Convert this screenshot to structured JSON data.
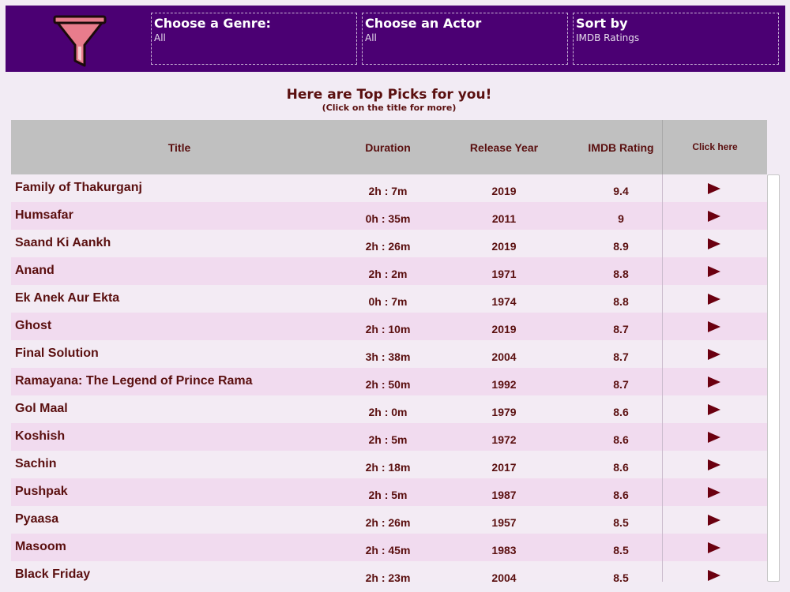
{
  "filters": {
    "genre": {
      "label": "Choose a Genre:",
      "value": "All"
    },
    "actor": {
      "label": "Choose an Actor",
      "value": "All"
    },
    "sort": {
      "label": "Sort by",
      "value": "IMDB Ratings"
    }
  },
  "heading": {
    "title": "Here are Top Picks for you!",
    "subtitle": "(Click on the title for more)"
  },
  "table": {
    "headers": {
      "title": "Title",
      "duration": "Duration",
      "year": "Release Year",
      "rating": "IMDB Rating",
      "click": "Click here"
    },
    "rows": [
      {
        "title": "Family of Thakurganj",
        "duration": "2h : 7m",
        "year": "2019",
        "rating": "9.4"
      },
      {
        "title": "Humsafar",
        "duration": "0h : 35m",
        "year": "2011",
        "rating": "9"
      },
      {
        "title": "Saand Ki Aankh",
        "duration": "2h : 26m",
        "year": "2019",
        "rating": "8.9"
      },
      {
        "title": "Anand",
        "duration": "2h : 2m",
        "year": "1971",
        "rating": "8.8"
      },
      {
        "title": "Ek Anek Aur Ekta",
        "duration": "0h : 7m",
        "year": "1974",
        "rating": "8.8"
      },
      {
        "title": "Ghost",
        "duration": "2h : 10m",
        "year": "2019",
        "rating": "8.7"
      },
      {
        "title": "Final Solution",
        "duration": "3h : 38m",
        "year": "2004",
        "rating": "8.7"
      },
      {
        "title": "Ramayana: The Legend of Prince Rama",
        "duration": "2h : 50m",
        "year": "1992",
        "rating": "8.7"
      },
      {
        "title": "Gol Maal",
        "duration": "2h : 0m",
        "year": "1979",
        "rating": "8.6"
      },
      {
        "title": "Koshish",
        "duration": "2h : 5m",
        "year": "1972",
        "rating": "8.6"
      },
      {
        "title": "Sachin",
        "duration": "2h : 18m",
        "year": "2017",
        "rating": "8.6"
      },
      {
        "title": "Pushpak",
        "duration": "2h : 5m",
        "year": "1987",
        "rating": "8.6"
      },
      {
        "title": "Pyaasa",
        "duration": "2h : 26m",
        "year": "1957",
        "rating": "8.5"
      },
      {
        "title": "Masoom",
        "duration": "2h : 45m",
        "year": "1983",
        "rating": "8.5"
      },
      {
        "title": "Black Friday",
        "duration": "2h : 23m",
        "year": "2004",
        "rating": "8.5"
      }
    ]
  },
  "icons": {
    "logo": "funnel-icon",
    "row_action": "play-icon"
  },
  "colors": {
    "header_bg": "#4b0073",
    "text": "#5a0f0f",
    "funnel_fill": "#e87c8c",
    "play": "#6b0010"
  }
}
